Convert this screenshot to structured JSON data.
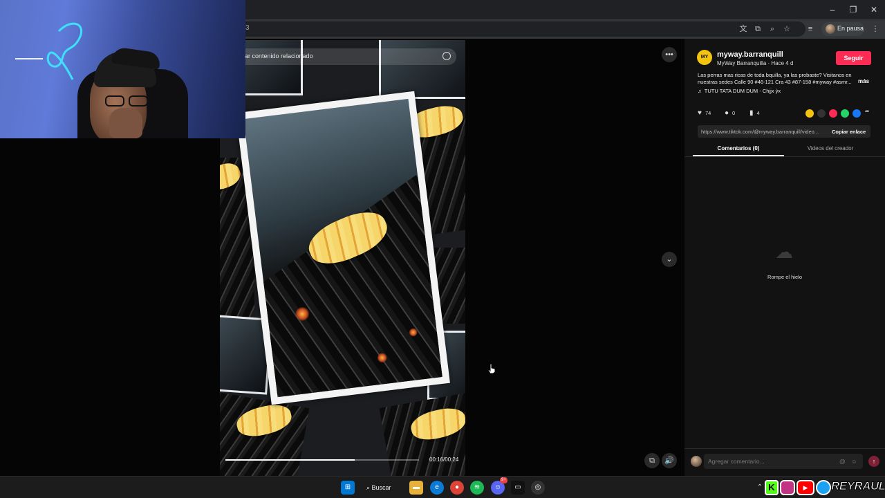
{
  "browser": {
    "url_fragment": "3",
    "profile_status": "En pausa"
  },
  "video": {
    "search_placeholder": "ar contenido relacionado",
    "time": "00:16/00:24",
    "progress_fraction": 0.667
  },
  "post": {
    "username": "myway.barranquill",
    "subtitle": "MyWay Barranquilla · Hace 4 d",
    "logo_text": "MY WAY",
    "follow_label": "Seguir",
    "description_line1": "Las perras mas ricas de toda bquilla, ya las probaste? Visitanos en",
    "description_line2": "nuestras sedes Calle 90 #46-121 Cra 43 #87-158 #myway #asmr...",
    "more_label": "más",
    "music": "TUTU TATA DUM DUM - Chjjx ỳx",
    "likes": "74",
    "comments": "0",
    "saves": "4",
    "link": "https://www.tiktok.com/@myway.barranquill/video...",
    "copy_label": "Copiar enlace"
  },
  "tabs": {
    "comments": "Comentarios (0)",
    "creator_videos": "Videos del creador"
  },
  "empty_state": {
    "text": "Rompe el hielo"
  },
  "comment_box": {
    "placeholder": "Agregar comentario..."
  },
  "taskbar": {
    "search_label": "Buscar",
    "discord_badge": "9+"
  },
  "overlay": {
    "banner_name": "REYRAUL"
  },
  "colors": {
    "follow": "#fe2c55",
    "accent_yellow": "#f2c40f"
  }
}
